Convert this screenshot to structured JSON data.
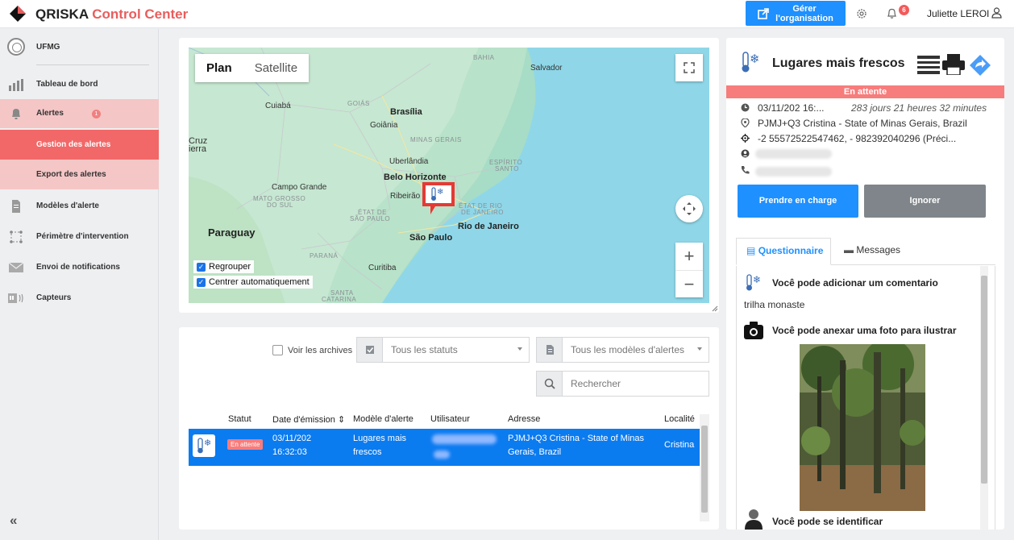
{
  "header": {
    "brand_main": "QRISKA",
    "brand_accent": "Control Center",
    "org_button_line1": "Gérer",
    "org_button_line2": "l'organisation",
    "notification_count": "6",
    "user_name": "Juliette LEROI"
  },
  "sidebar": {
    "org_name": "UFMG",
    "items": [
      {
        "label": "Tableau de bord",
        "icon": "bar-chart-icon"
      },
      {
        "label": "Alertes",
        "icon": "bell-icon",
        "count": "1"
      },
      {
        "label": "Gestion des alertes"
      },
      {
        "label": "Export des alertes"
      },
      {
        "label": "Modèles d'alerte",
        "icon": "document-icon"
      },
      {
        "label": "Périmètre d'intervention",
        "icon": "perimeter-icon"
      },
      {
        "label": "Envoi de notifications",
        "icon": "envelope-icon"
      },
      {
        "label": "Capteurs",
        "icon": "sensor-icon"
      }
    ],
    "collapse_label": "«"
  },
  "map": {
    "tab_plan": "Plan",
    "tab_satellite": "Satellite",
    "checkbox_group": "Regrouper",
    "checkbox_center": "Centrer automatiquement",
    "zoom_in": "+",
    "zoom_out": "−",
    "places": {
      "bahia": "BAHIA",
      "salvador": "Salvador",
      "goias": "GOIÁS",
      "brasilia": "Brasília",
      "goiania": "Goiânia",
      "cuiaba": "Cuiabá",
      "minas": "MINAS GERAIS",
      "uberlandia": "Uberlândia",
      "espirito1": "ESPÍRITO",
      "espirito2": "SANTO",
      "belo": "Belo Horizonte",
      "campo": "Campo Grande",
      "ribeirao": "Ribeirão",
      "mato1": "MATO GROSSO",
      "mato2": "DO SUL",
      "etatsp1": "ÉTAT DE",
      "etatsp2": "SÃO PAULO",
      "etatrj1": "ÉTAT DE RIO",
      "etatrj2": "DE JANEIRO",
      "rio": "Rio de Janeiro",
      "saopaulo": "São Paulo",
      "paraguay": "Paraguay",
      "parana": "PARANÁ",
      "curitiba": "Curitiba",
      "cruz1": "Cruz",
      "cruz2": "ierra",
      "santa": "SANTA",
      "catarina": "CATARINA"
    }
  },
  "filters": {
    "archives_label": "Voir les archives",
    "status_value": "Tous les statuts",
    "model_value": "Tous les modèles d'alertes",
    "search_placeholder": "Rechercher"
  },
  "table": {
    "headers": {
      "status": "Statut",
      "date": "Date d'émission",
      "sort_icon": "⇕",
      "model": "Modèle d'alerte",
      "user": "Utilisateur",
      "address": "Adresse",
      "locality": "Localité"
    },
    "rows": [
      {
        "status": "En attente",
        "date_line1": "03/11/202",
        "date_line2": "16:32:03",
        "model_line1": "Lugares mais",
        "model_line2": "frescos",
        "address_line1": "PJMJ+Q3 Cristina - State of Minas",
        "address_line2": "Gerais, Brazil",
        "locality": "Cristina"
      }
    ]
  },
  "detail": {
    "title": "Lugares mais frescos",
    "status": "En attente",
    "date": "03/11/202  16:...",
    "duration": "283 jours 21 heures 32 minutes",
    "address": "PJMJ+Q3 Cristina - State of Minas Gerais, Brazil",
    "coords": "-2     55572522547462, -      982392040296 (Préci...",
    "btn_take": "Prendre en charge",
    "btn_ignore": "Ignorer",
    "tab_questionnaire": "Questionnaire",
    "tab_messages": "Messages",
    "q1_title": "Você pode adicionar um comentario",
    "q1_answer": "trilha monaste",
    "q2_title": "Você pode anexar uma foto para ilustrar",
    "q3_title": "Você pode se identificar"
  },
  "colors": {
    "accent_red": "#e95d5d",
    "primary_blue": "#1e90ff",
    "selected_row": "#0b7bf0",
    "status_pending": "#f77c7c"
  }
}
